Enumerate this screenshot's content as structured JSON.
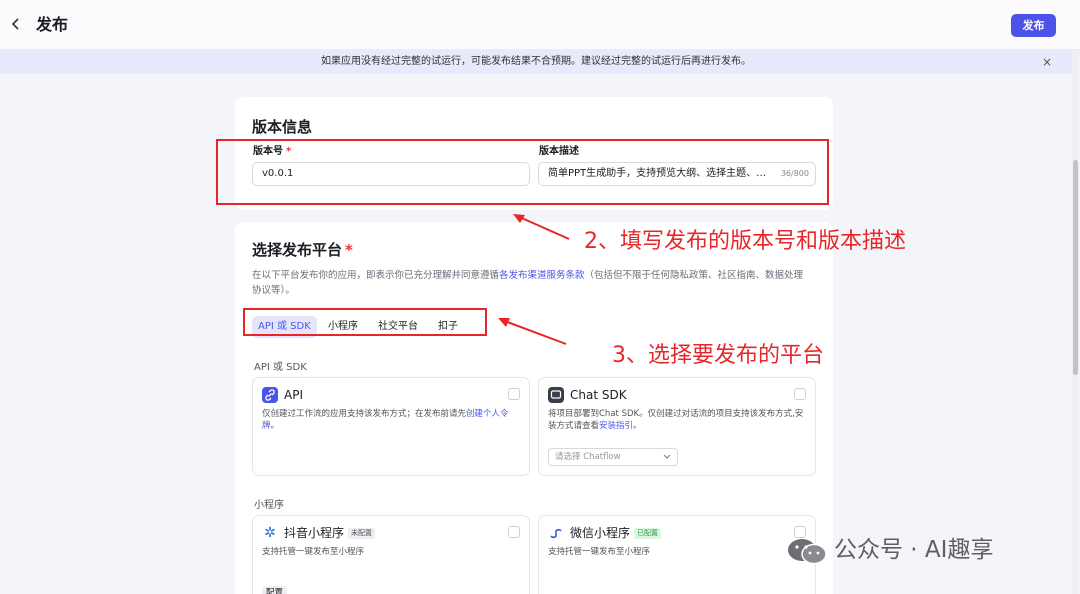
{
  "header": {
    "back_icon": "chevron-left-icon",
    "title": "发布",
    "publish_label": "发布"
  },
  "notice": {
    "text": "如果应用没有经过完整的试运行，可能发布结果不合预期。建议经过完整的试运行后再进行发布。",
    "close": "×"
  },
  "version_info": {
    "title": "版本信息",
    "version_label": "版本号",
    "version_value": "v0.0.1",
    "desc_label": "版本描述",
    "desc_value": "简单PPT生成助手，支持预览大纲、选择主题、…",
    "desc_counter": "36/800"
  },
  "platform": {
    "title": "选择发布平台",
    "required_mark": "*",
    "desc_before": "在以下平台发布你的应用，即表示你已充分理解并同意遵循",
    "desc_link": "各发布渠道服务条款",
    "desc_after": "（包括但不限于任何隐私政策、社区指南、数据处理协议等）。",
    "tabs": [
      "API 或 SDK",
      "小程序",
      "社交平台",
      "扣子"
    ],
    "group_api": "API 或 SDK",
    "group_mini": "小程序",
    "cards": {
      "api": {
        "title": "API",
        "desc": "仅创建过工作流的应用支持该发布方式；在发布前请先",
        "link": "创建个人令牌",
        "desc_end": "。"
      },
      "chat_sdk": {
        "title": "Chat SDK",
        "desc": "将项目部署到Chat SDK。仅创建过对话流的项目支持该发布方式,安装方式请查看",
        "link": "安装指引",
        "desc_end": "。",
        "select_placeholder": "请选择 Chatflow"
      },
      "douyin": {
        "title": "抖音小程序",
        "badge": "未配置",
        "desc": "支持托管一键发布至小程序",
        "configure": "配置"
      },
      "wechat": {
        "title": "微信小程序",
        "badge": "已配置",
        "desc": "支持托管一键发布至小程序"
      }
    }
  },
  "annotations": {
    "step2": "2、填写发布的版本号和版本描述",
    "step3": "3、选择要发布的平台"
  },
  "watermark": {
    "text": "公众号 · AI趣享"
  },
  "colors": {
    "accent": "#4d53e8",
    "annotation_red": "#e8262a",
    "required_red": "#e7323a"
  }
}
